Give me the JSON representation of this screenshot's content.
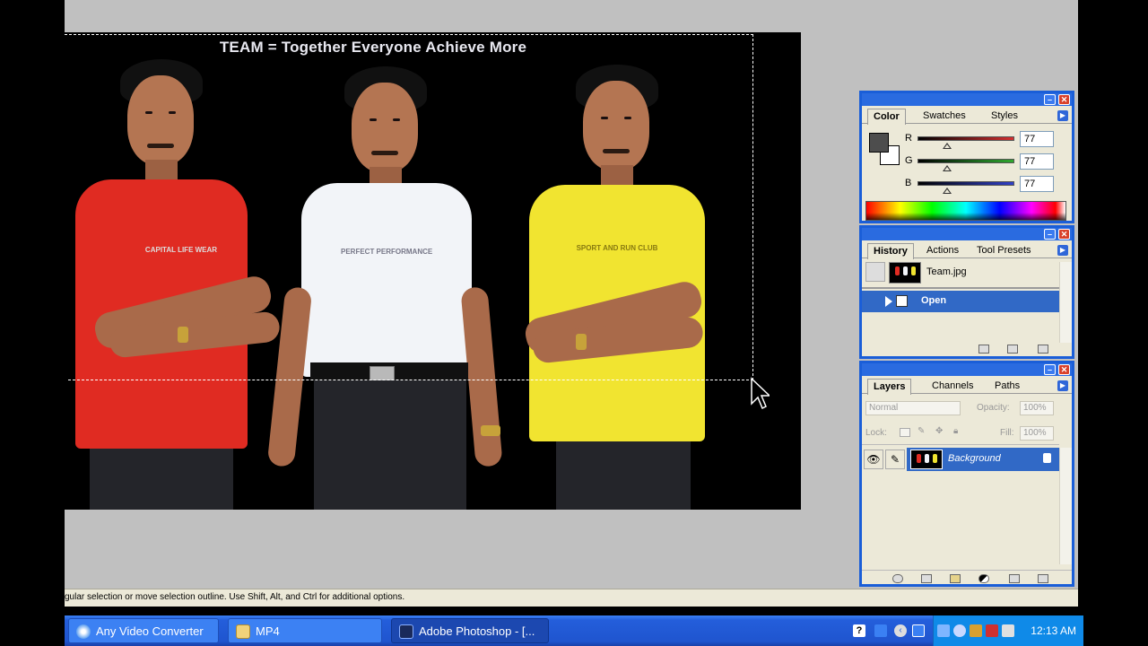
{
  "document": {
    "title_text": "TEAM = Together Everyone Achieve More",
    "shirt_prints": [
      "CAPITAL LIFE WEAR",
      "PERFECT PERFORMANCE",
      "SPORT AND RUN CLUB"
    ]
  },
  "color_palette": {
    "tabs": [
      "Color",
      "Swatches",
      "Styles"
    ],
    "channels": [
      {
        "label": "R",
        "value": "77",
        "color": "#d43030"
      },
      {
        "label": "G",
        "value": "77",
        "color": "#2fa82f"
      },
      {
        "label": "B",
        "value": "77",
        "color": "#3040c8"
      }
    ],
    "foreground": "#4d4d4d",
    "background": "#ffffff"
  },
  "history_palette": {
    "tabs": [
      "History",
      "Actions",
      "Tool Presets"
    ],
    "snapshot_label": "Team.jpg",
    "states": [
      {
        "label": "Open",
        "selected": true
      }
    ]
  },
  "layers_palette": {
    "tabs": [
      "Layers",
      "Channels",
      "Paths"
    ],
    "blend_mode": "Normal",
    "opacity_label": "Opacity:",
    "opacity_value": "100%",
    "lock_label": "Lock:",
    "fill_label": "Fill:",
    "fill_value": "100%",
    "layers": [
      {
        "name": "Background",
        "visible": true,
        "locked": true
      }
    ]
  },
  "status_bar": {
    "text": "gular selection or move selection outline.  Use Shift, Alt, and Ctrl for additional options."
  },
  "taskbar": {
    "buttons": [
      {
        "label": "Any Video Converter",
        "icon": "any-video-converter-icon",
        "active": false
      },
      {
        "label": "MP4",
        "icon": "folder-icon",
        "active": false
      },
      {
        "label": "Adobe Photoshop - [...",
        "icon": "photoshop-icon",
        "active": true
      }
    ],
    "clock": "12:13 AM"
  },
  "colors": {
    "xp_blue": "#245edb",
    "selection_blue": "#3169c6",
    "workspace_gray": "#c0c0c0"
  }
}
